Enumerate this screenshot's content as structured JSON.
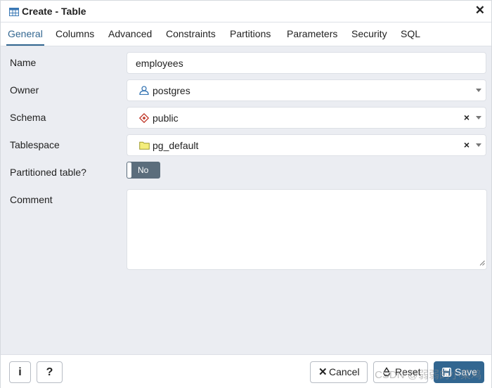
{
  "dialog": {
    "title": "Create - Table",
    "close_icon": "✕"
  },
  "tabs": [
    {
      "label": "General",
      "active": true
    },
    {
      "label": "Columns"
    },
    {
      "label": "Advanced"
    },
    {
      "label": "Constraints"
    },
    {
      "label": "Partitions"
    },
    {
      "label": "Parameters"
    },
    {
      "label": "Security"
    },
    {
      "label": "SQL"
    }
  ],
  "form": {
    "name": {
      "label": "Name",
      "value": "employees"
    },
    "owner": {
      "label": "Owner",
      "value": "postgres",
      "icon": "user-icon"
    },
    "schema": {
      "label": "Schema",
      "value": "public",
      "icon": "schema-icon",
      "clear": "×"
    },
    "tablespace": {
      "label": "Tablespace",
      "value": "pg_default",
      "icon": "folder-icon",
      "clear": "×"
    },
    "partitioned": {
      "label": "Partitioned table?",
      "value": "No"
    },
    "comment": {
      "label": "Comment",
      "value": ""
    }
  },
  "footer": {
    "info_label": "i",
    "help_label": "?",
    "cancel_label": "Cancel",
    "reset_label": "Reset",
    "save_label": "Save"
  },
  "watermark": "CSDN @弱弱的小菜鸡",
  "colors": {
    "accent": "#326690",
    "toggle_off": "#5b6d7c",
    "background": "#ebedf2"
  }
}
